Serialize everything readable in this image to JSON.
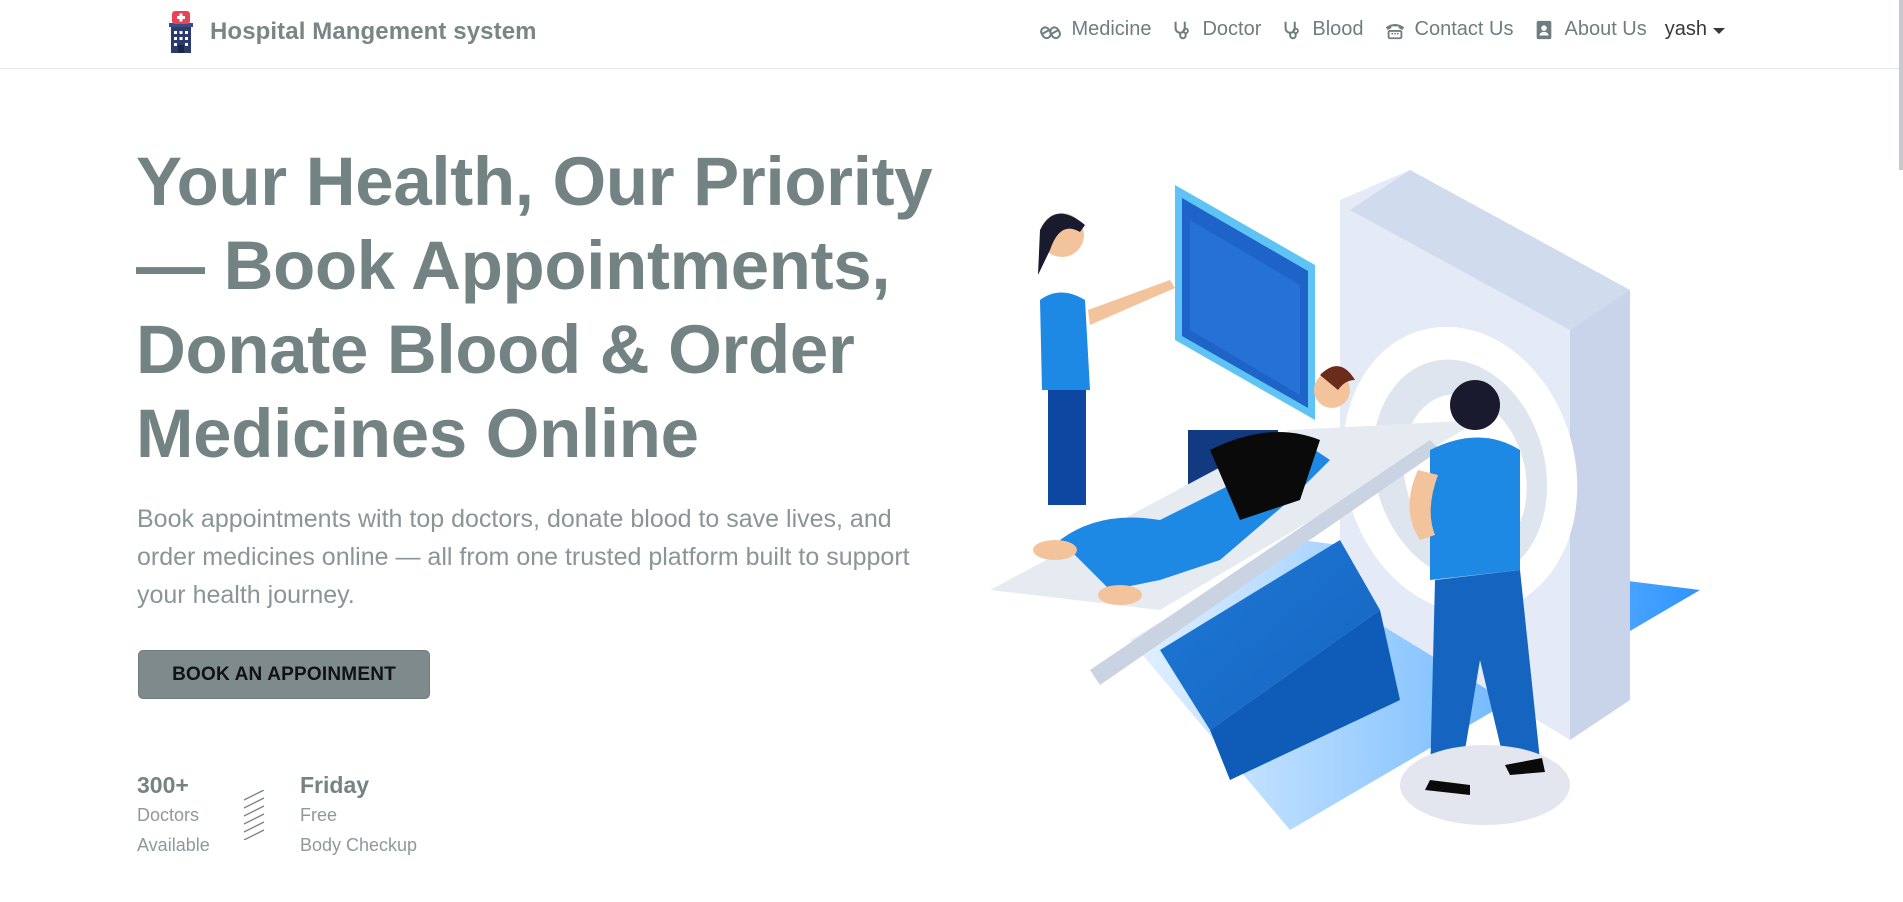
{
  "brand": {
    "name": "Hospital Mangement system"
  },
  "nav": {
    "items": [
      {
        "label": "Medicine",
        "icon": "capsules-icon"
      },
      {
        "label": "Doctor",
        "icon": "stethoscope-icon"
      },
      {
        "label": "Blood",
        "icon": "stethoscope-icon"
      },
      {
        "label": "Contact Us",
        "icon": "phone-icon"
      },
      {
        "label": "About Us",
        "icon": "address-book-icon"
      }
    ],
    "user": "yash"
  },
  "hero": {
    "title": "Your Health, Our Priority — Book Appointments, Donate Blood & Order Medicines Online",
    "subtitle": "Book appointments with top doctors, donate blood to save lives, and order medicines online — all from one trusted platform built to support your health journey.",
    "cta_label": "BOOK AN APPOINMENT"
  },
  "stats": [
    {
      "value": "300+",
      "line1": "Doctors",
      "line2": "Available"
    },
    {
      "value": "Friday",
      "line1": "Free",
      "line2": "Body Checkup"
    }
  ],
  "colors": {
    "accent_blue": "#1e88e5",
    "heading_gray": "#738283",
    "button_bg": "#7e8a8b",
    "logo_red": "#e84357"
  }
}
